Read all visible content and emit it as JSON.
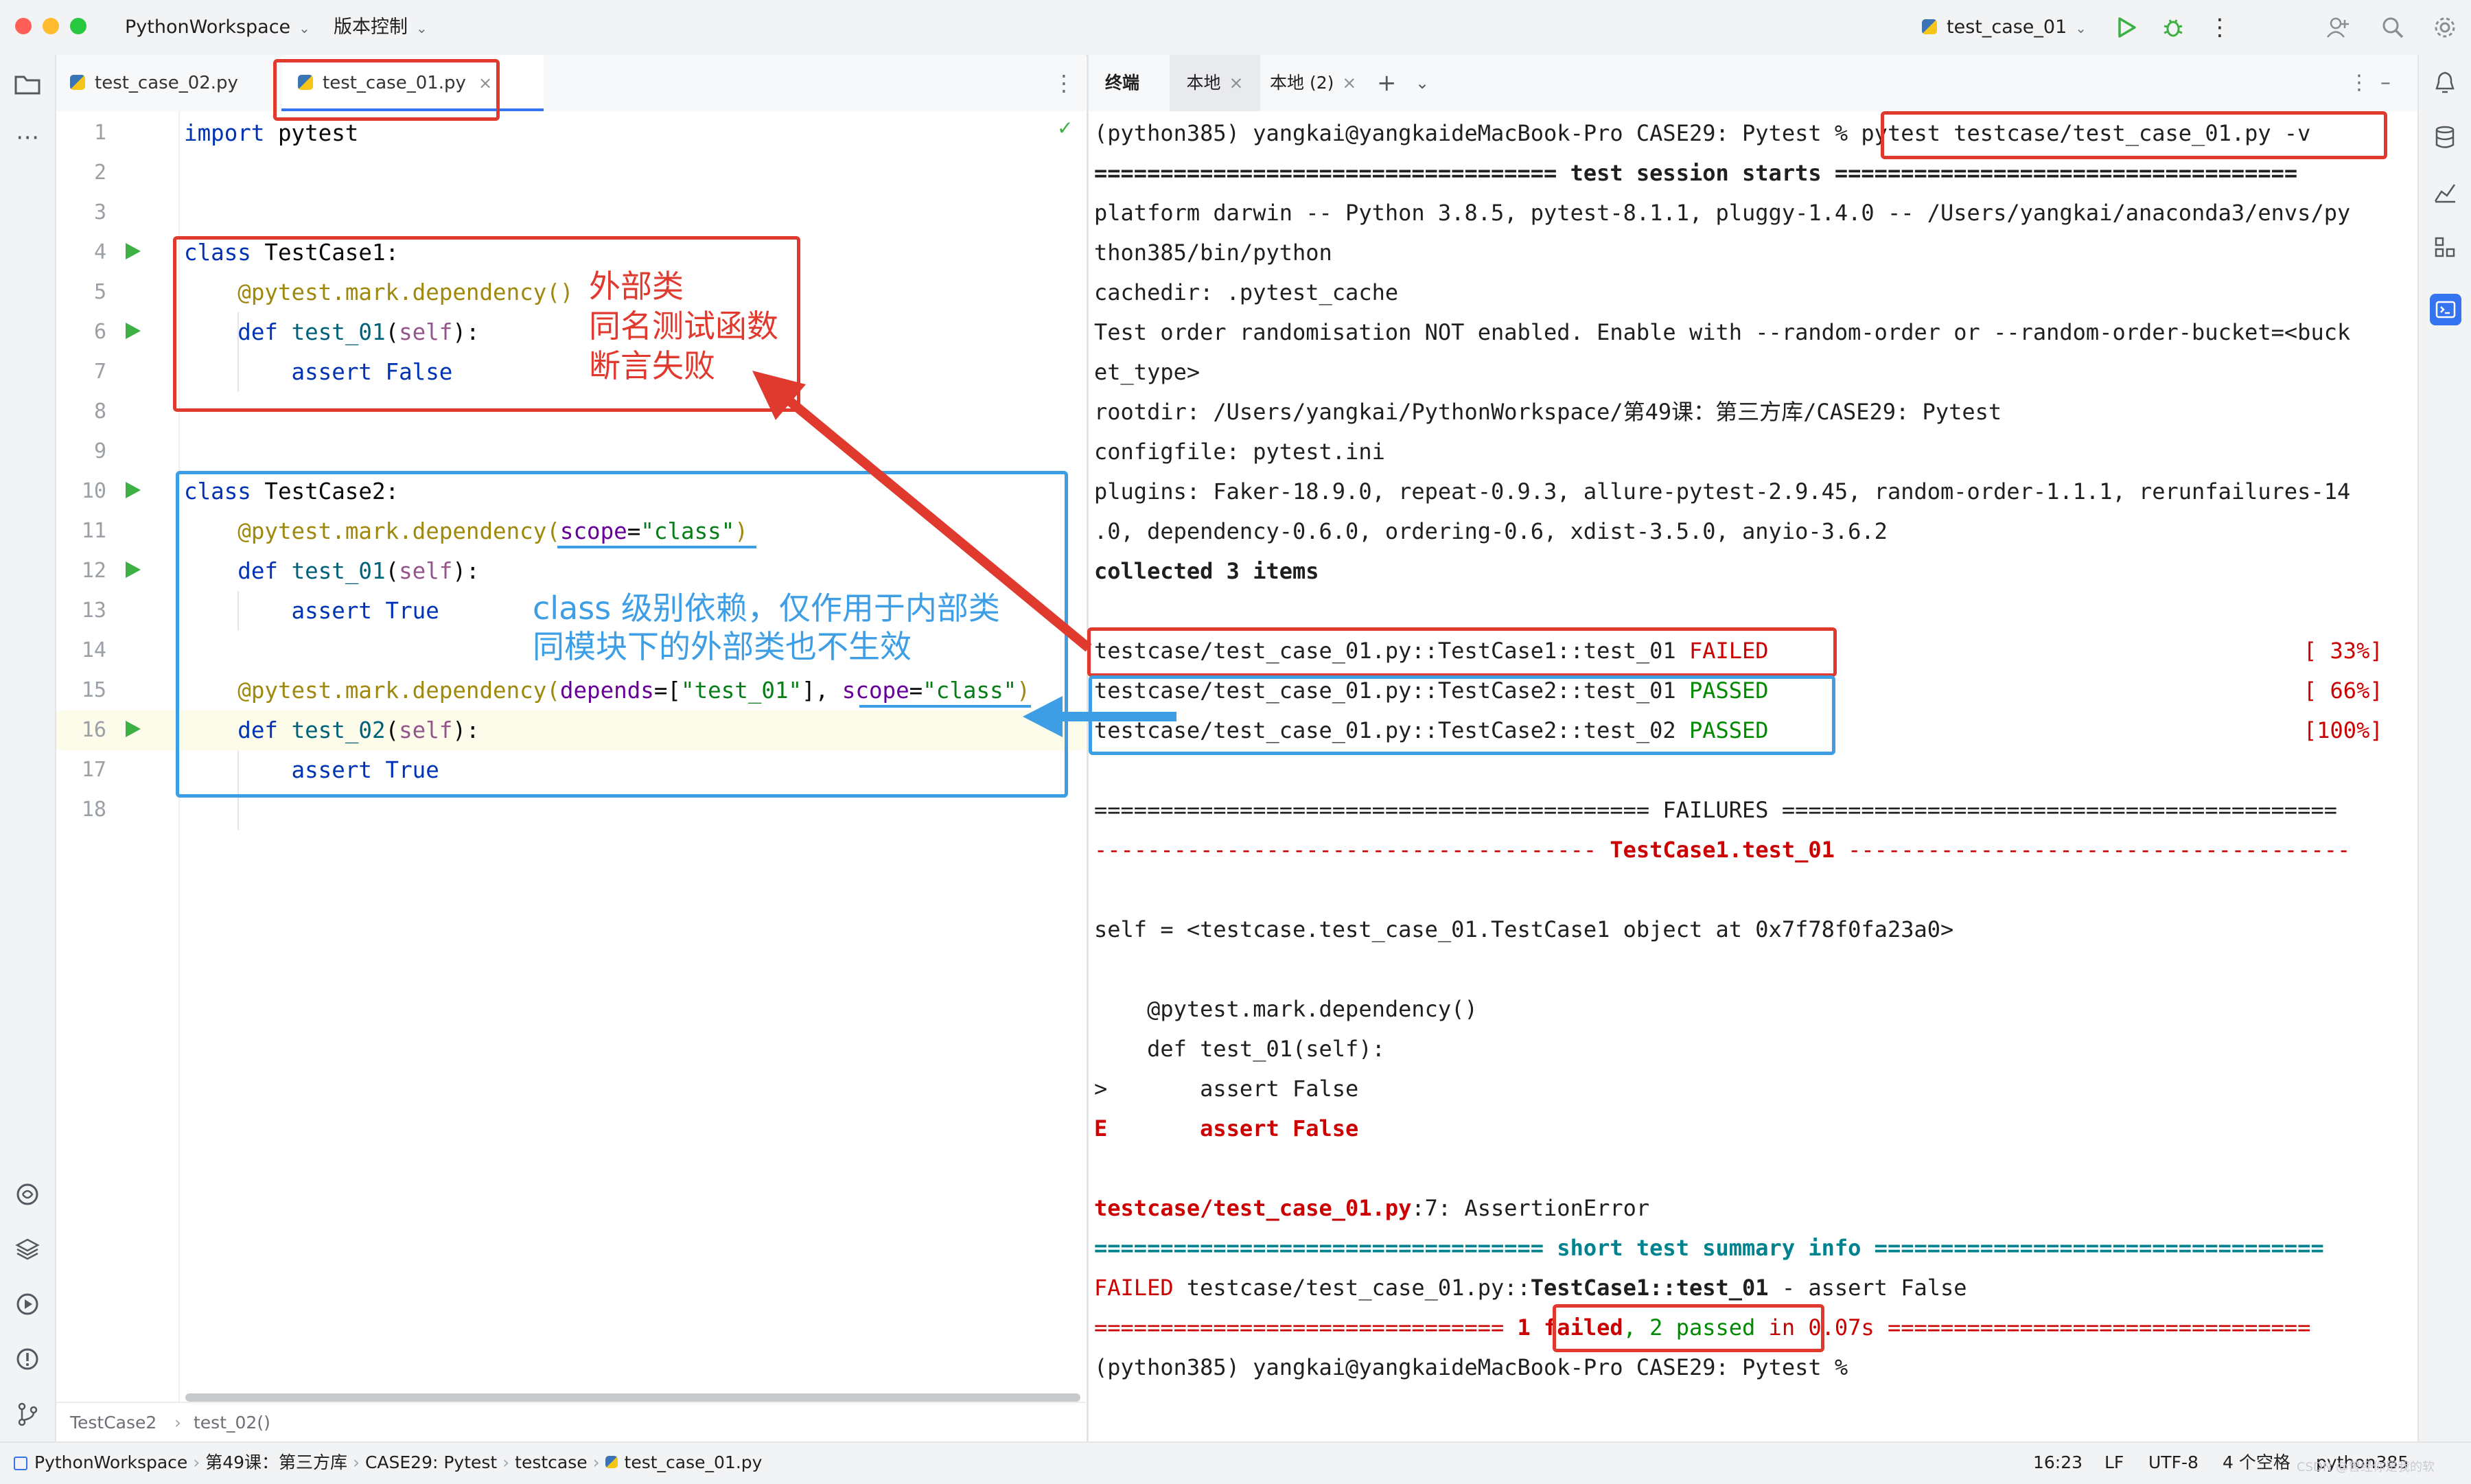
{
  "titlebar": {
    "project": "PythonWorkspace",
    "vcs": "版本控制",
    "run_config": "test_case_01"
  },
  "editor": {
    "tabs": [
      {
        "label": "test_case_02.py",
        "active": false
      },
      {
        "label": "test_case_01.py",
        "active": true
      }
    ],
    "line_numbers": [
      "1",
      "2",
      "3",
      "4",
      "5",
      "6",
      "7",
      "8",
      "9",
      "10",
      "11",
      "12",
      "13",
      "14",
      "15",
      "16",
      "17",
      "18"
    ],
    "breadcrumb": [
      "TestCase2",
      "test_02()"
    ]
  },
  "annotations": {
    "outer_class": [
      "外部类",
      "同名测试函数",
      "断言失败"
    ],
    "class_scope": [
      "class 级别依赖，仅作用于内部类",
      "同模块下的外部类也不生效"
    ]
  },
  "terminal": {
    "tabs": [
      "终端",
      "本地",
      "本地 (2)"
    ],
    "prompt": "(python385) yangkai@yangkaideMacBook-Pro CASE29: Pytest % ",
    "command": "pytest testcase/test_case_01.py -v",
    "session_starts": "=================================== test session starts ===================================",
    "platform_1": "platform darwin -- Python 3.8.5, pytest-8.1.1, pluggy-1.4.0 -- /Users/yangkai/anaconda3/envs/py",
    "platform_2": "thon385/bin/python",
    "cachedir": "cachedir: .pytest_cache",
    "order_1": "Test order randomisation NOT enabled. Enable with --random-order or --random-order-bucket=<buck",
    "order_2": "et_type>",
    "rootdir": "rootdir: /Users/yangkai/PythonWorkspace/第49课：第三方库/CASE29: Pytest",
    "configfile": "configfile: pytest.ini",
    "plugins_1": "plugins: Faker-18.9.0, repeat-0.9.3, allure-pytest-2.9.45, random-order-1.1.1, rerunfailures-14",
    "plugins_2": ".0, dependency-0.6.0, ordering-0.6, xdist-3.5.0, anyio-3.6.2",
    "collected": "collected 3 items",
    "results": [
      {
        "test": "testcase/test_case_01.py::TestCase1::test_01 ",
        "status": "FAILED",
        "pct": "[ 33%]"
      },
      {
        "test": "testcase/test_case_01.py::TestCase2::test_01 ",
        "status": "PASSED",
        "pct": "[ 66%]"
      },
      {
        "test": "testcase/test_case_01.py::TestCase2::test_02 ",
        "status": "PASSED",
        "pct": "[100%]"
      }
    ],
    "failures_header": "========================================== FAILURES ==========================================",
    "failure_title_left": "-------------------------------------- ",
    "failure_title": "TestCase1.test_01",
    "failure_title_right": " --------------------------------------",
    "self_line": "self = <testcase.test_case_01.TestCase1 object at 0x7f78f0fa23a0>",
    "tb_deco": "    @pytest.mark.dependency()",
    "tb_def": "    def test_01(self):",
    "tb_arrow": ">       assert False",
    "tb_E": "E",
    "tb_E_text": "       assert False",
    "err_loc": "testcase/test_case_01.py",
    "err_rest": ":7: AssertionError",
    "summary_header": "================================== short test summary info ==================================",
    "summary_failed": "FAILED",
    "summary_path": " testcase/test_case_01.py::",
    "summary_test": "TestCase1::test_01",
    "summary_rest": " - assert False",
    "final_left": "===============================",
    "final_failed": "1 failed",
    "final_comma": ", ",
    "final_passed": "2 passed",
    "final_time": " in 0.07s ================================",
    "prompt_end": "(python385) yangkai@yangkaideMacBook-Pro CASE29: Pytest %"
  },
  "statusbar": {
    "breadcrumb": [
      "PythonWorkspace",
      "第49课：第三方库",
      "CASE29: Pytest",
      "testcase",
      "test_case_01.py"
    ],
    "position": "16:23",
    "line_sep": "LF",
    "encoding": "UTF-8",
    "indent": "4 个空格",
    "interpreter": "python385",
    "watermark": "CSDN @曾经你是我的软"
  },
  "colors": {
    "annotation_red": "#e03a2f",
    "annotation_blue": "#3d9ee6",
    "failed": "#cc0000",
    "passed": "#008a00"
  }
}
